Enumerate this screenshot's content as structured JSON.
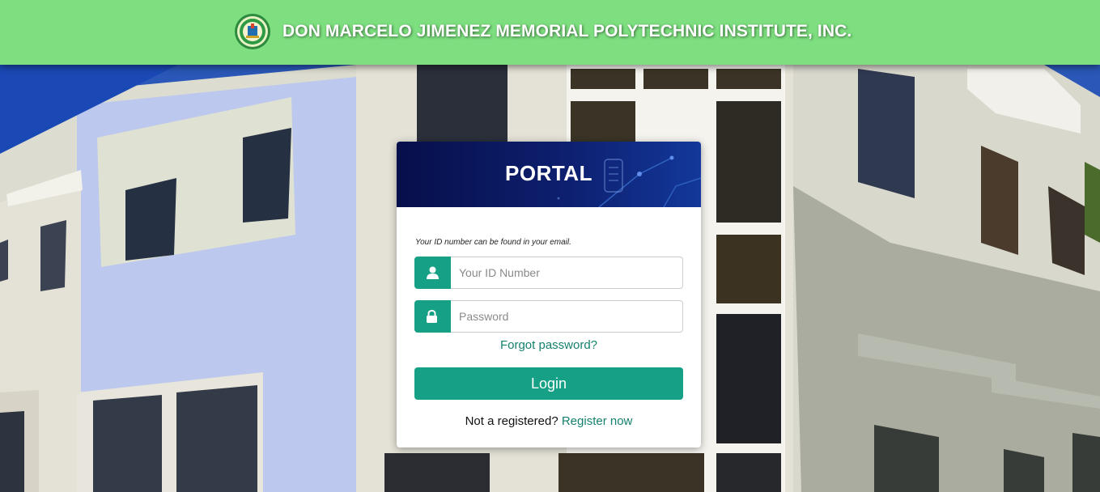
{
  "header": {
    "school_name": "DON MARCELO JIMENEZ MEMORIAL POLYTECHNIC INSTITUTE, INC.",
    "logo_icon": "school-seal-icon",
    "background_color": "#7ddf7f"
  },
  "portal": {
    "title": "PORTAL",
    "hint": "Your ID number can be found in your email.",
    "id_field": {
      "placeholder": "Your ID Number",
      "value": "",
      "icon": "user-icon"
    },
    "password_field": {
      "placeholder": "Password",
      "value": "",
      "icon": "lock-icon"
    },
    "forgot_label": "Forgot password?",
    "login_label": "Login",
    "register_prompt": "Not a registered?",
    "register_label": "Register now",
    "accent_color": "#16a085",
    "link_color": "#16806e"
  }
}
